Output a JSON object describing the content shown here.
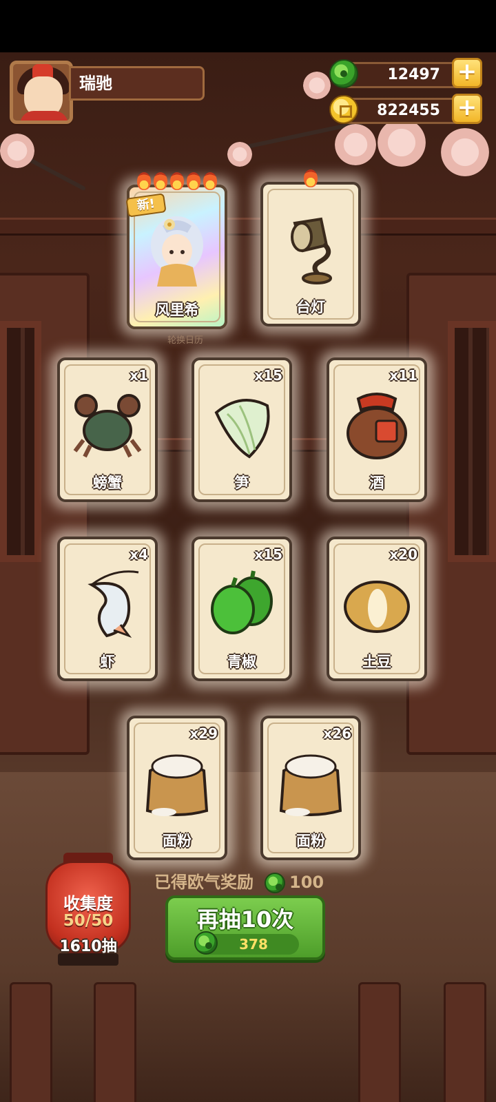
{
  "player": {
    "name": "瑞驰"
  },
  "currencies": [
    {
      "icon": "jade-coin-icon",
      "value": "12497"
    },
    {
      "icon": "gold-coin-icon",
      "value": "822455"
    }
  ],
  "plus_symbol": "+",
  "featured_cards": [
    {
      "name": "风里希",
      "new_tag": "新!",
      "stars": 5,
      "type": "character"
    },
    {
      "name": "台灯",
      "stars": 1,
      "type": "item"
    }
  ],
  "faint_label": "轮换日历",
  "cards": [
    {
      "name": "螃蟹",
      "qty": "x1"
    },
    {
      "name": "笋",
      "qty": "x15"
    },
    {
      "name": "酒",
      "qty": "x11"
    },
    {
      "name": "虾",
      "qty": "x4"
    },
    {
      "name": "青椒",
      "qty": "x15"
    },
    {
      "name": "土豆",
      "qty": "x20"
    },
    {
      "name": "面粉",
      "qty": "x29"
    },
    {
      "name": "面粉",
      "qty": "x26"
    }
  ],
  "collection": {
    "title": "收集度",
    "progress": "50/50",
    "draws": "1610抽"
  },
  "reward": {
    "label": "已得欧气奖励",
    "amount": "100"
  },
  "redraw": {
    "label": "再抽10次",
    "cost": "378"
  },
  "colors": {
    "accent_green": "#4e9e2a",
    "gold": "#f2b628",
    "lantern_red": "#c3301f"
  }
}
